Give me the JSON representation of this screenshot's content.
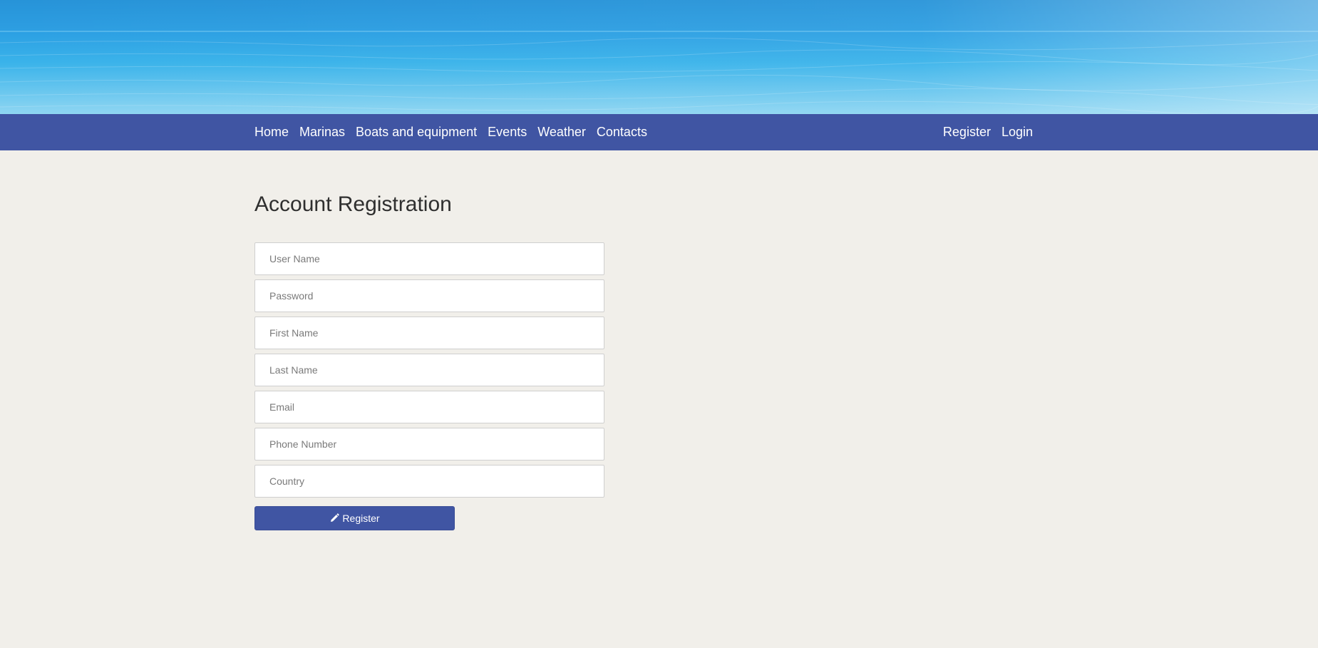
{
  "nav": {
    "left": [
      {
        "label": "Home"
      },
      {
        "label": "Marinas"
      },
      {
        "label": "Boats and equipment"
      },
      {
        "label": "Events"
      },
      {
        "label": "Weather"
      },
      {
        "label": "Contacts"
      }
    ],
    "right": [
      {
        "label": "Register"
      },
      {
        "label": "Login"
      }
    ]
  },
  "page": {
    "title": "Account Registration"
  },
  "form": {
    "fields": [
      {
        "placeholder": "User Name",
        "value": ""
      },
      {
        "placeholder": "Password",
        "value": ""
      },
      {
        "placeholder": "First Name",
        "value": ""
      },
      {
        "placeholder": "Last Name",
        "value": ""
      },
      {
        "placeholder": "Email",
        "value": ""
      },
      {
        "placeholder": "Phone Number",
        "value": ""
      },
      {
        "placeholder": "Country",
        "value": ""
      }
    ],
    "submit_label": "Register",
    "submit_icon": "pencil-icon"
  },
  "colors": {
    "nav_background": "#4055a3",
    "page_background": "#f1efea",
    "button_background": "#4055a3"
  }
}
